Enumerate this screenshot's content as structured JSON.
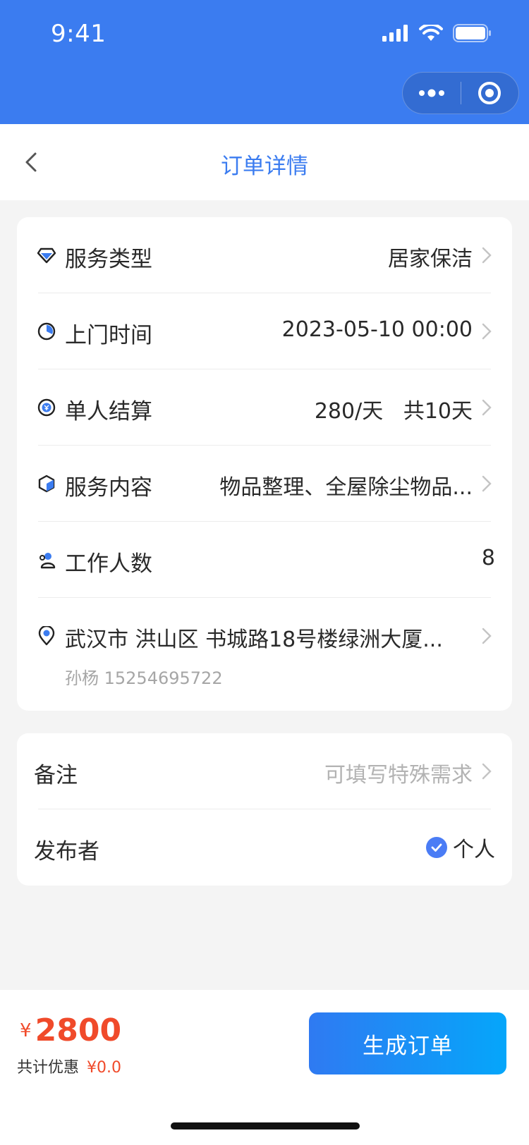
{
  "status_bar": {
    "time": "9:41"
  },
  "nav": {
    "title": "订单详情"
  },
  "details": {
    "service_type": {
      "label": "服务类型",
      "value": "居家保洁"
    },
    "visit_time": {
      "label": "上门时间",
      "value": "2023-05-10 00:00"
    },
    "settlement": {
      "label": "单人结算",
      "value": "280/天   共10天"
    },
    "service_content": {
      "label": "服务内容",
      "value": "物品整理、全屋除尘物品..."
    },
    "worker_count": {
      "label": "工作人数",
      "value": "8"
    },
    "address": {
      "line": "武汉市 洪山区 书城路18号楼绿洲大厦...",
      "contact": "孙杨 15254695722"
    }
  },
  "extra": {
    "remark": {
      "label": "备注",
      "placeholder": "可填写特殊需求"
    },
    "publisher": {
      "label": "发布者",
      "value": "个人"
    }
  },
  "footer": {
    "currency": "¥",
    "total": "2800",
    "discount_label": "共计优惠",
    "discount_value": "¥0.0",
    "submit_label": "生成订单"
  },
  "colors": {
    "primary": "#3b7cf0",
    "price": "#f04a2a"
  },
  "icons": [
    "signal-icon",
    "wifi-icon",
    "battery-icon",
    "more-dots-icon",
    "target-icon",
    "back-chevron-icon",
    "diamond-icon",
    "clock-icon",
    "coin-icon",
    "cube-icon",
    "people-icon",
    "location-pin-icon",
    "chevron-right-icon",
    "check-icon"
  ]
}
